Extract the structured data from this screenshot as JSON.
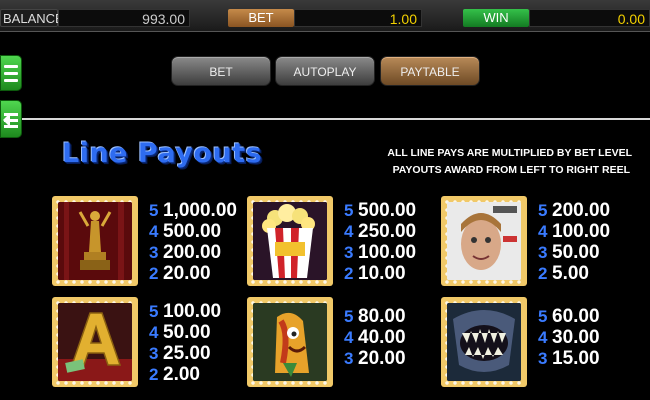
{
  "topbar": {
    "balance_label": "BALANCE",
    "balance_value": "993.00",
    "bet_label": "BET",
    "bet_value": "1.00",
    "win_label": "WIN",
    "win_value": "0.00"
  },
  "side": {
    "menu_icon": "hamburger-icon",
    "back_icon": "back-arrow-icon"
  },
  "tabs": [
    {
      "label": "BET",
      "active": false
    },
    {
      "label": "AUTOPLAY",
      "active": false
    },
    {
      "label": "PAYTABLE",
      "active": true
    }
  ],
  "paytable": {
    "title": "Line Payouts",
    "note_1": "ALL LINE PAYS ARE MULTIPLIED BY BET LEVEL",
    "note_2": "PAYOUTS AWARD FROM LEFT TO RIGHT REEL",
    "symbols": [
      {
        "icon": "golden-statuette-icon",
        "pays": [
          [
            "5",
            "1,000.00"
          ],
          [
            "4",
            "500.00"
          ],
          [
            "3",
            "200.00"
          ],
          [
            "2",
            "20.00"
          ]
        ]
      },
      {
        "icon": "popcorn-icon",
        "pays": [
          [
            "5",
            "500.00"
          ],
          [
            "4",
            "250.00"
          ],
          [
            "3",
            "100.00"
          ],
          [
            "2",
            "10.00"
          ]
        ]
      },
      {
        "icon": "magazine-cover-icon",
        "pays": [
          [
            "5",
            "200.00"
          ],
          [
            "4",
            "100.00"
          ],
          [
            "3",
            "50.00"
          ],
          [
            "2",
            "5.00"
          ]
        ]
      },
      {
        "icon": "golden-letter-a-icon",
        "pays": [
          [
            "5",
            "100.00"
          ],
          [
            "4",
            "50.00"
          ],
          [
            "3",
            "25.00"
          ],
          [
            "2",
            "2.00"
          ]
        ]
      },
      {
        "icon": "cartoon-hotdog-icon",
        "pays": [
          [
            "5",
            "80.00"
          ],
          [
            "4",
            "40.00"
          ],
          [
            "3",
            "20.00"
          ]
        ]
      },
      {
        "icon": "monster-mouth-icon",
        "pays": [
          [
            "5",
            "60.00"
          ],
          [
            "4",
            "30.00"
          ],
          [
            "3",
            "15.00"
          ]
        ]
      }
    ]
  }
}
